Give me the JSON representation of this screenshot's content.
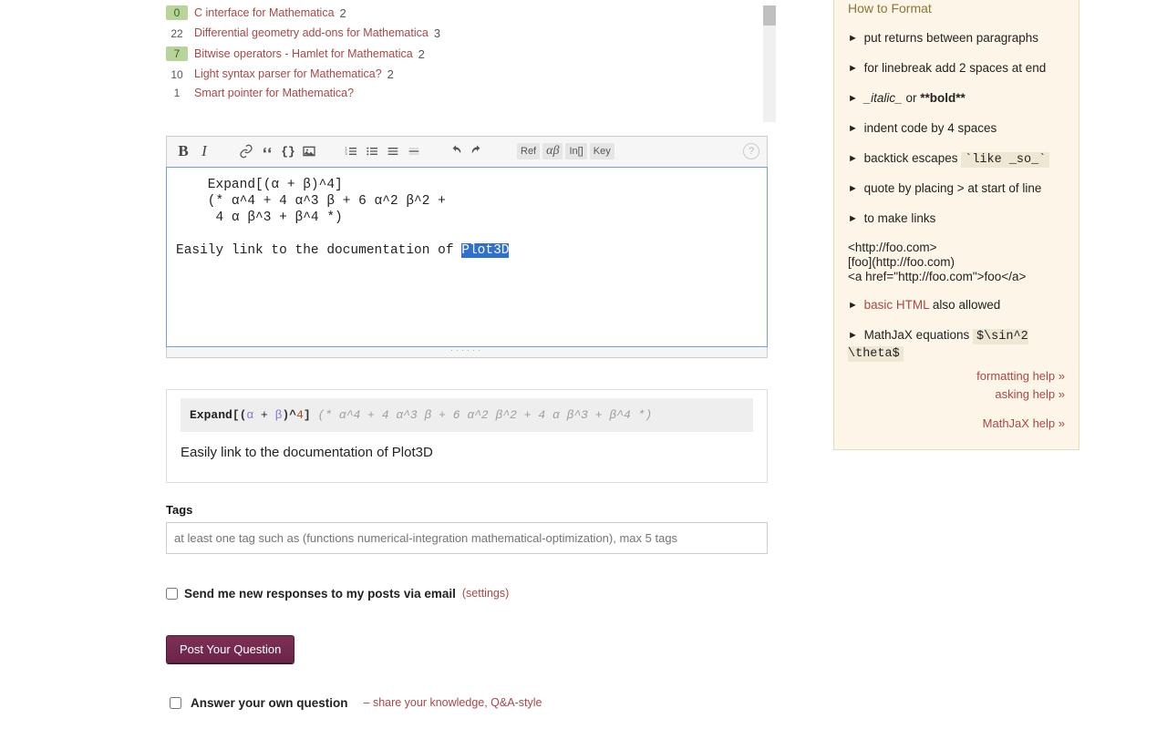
{
  "related": [
    {
      "votes": "0",
      "answered": true,
      "title": "C interface for Mathematica",
      "count": "2"
    },
    {
      "votes": "22",
      "answered": false,
      "title": "Differential geometry add-ons for Mathematica",
      "count": "3"
    },
    {
      "votes": "7",
      "answered": true,
      "title": "Bitwise operators - Hamlet for Mathematica",
      "count": "2"
    },
    {
      "votes": "10",
      "answered": false,
      "title": "Light syntax parser for Mathematica?",
      "count": "2"
    },
    {
      "votes": "1",
      "answered": false,
      "title": "Smart pointer for Mathematica?",
      "count": ""
    }
  ],
  "editor": {
    "line1": "    Expand[(α + β)^4]",
    "line2": "    (* α^4 + 4 α^3 β + 6 α^2 β^2 +",
    "line3": "     4 α β^3 + β^4 *)",
    "line5a": "Easily link to the documentation of ",
    "sel": "Plot3D"
  },
  "preview": {
    "code_kw": "Expand",
    "code_open": "[(",
    "code_a": "α",
    "code_plus": " + ",
    "code_b": "β",
    "code_close_exp": ")^",
    "code_exp": "4",
    "code_end": "]",
    "code_cmt1": "(* α^4 + 4 α^3 β + 6 α^2 β^2 +",
    "code_cmt2": " 4 α β^3 + β^4 *)",
    "text": "Easily link to the documentation of Plot3D"
  },
  "tags": {
    "label": "Tags",
    "placeholder": "at least one tag such as (functions numerical-integration mathematical-optimization), max 5 tags"
  },
  "email": {
    "text": "Send me new responses to my posts via email",
    "settings": "(settings)"
  },
  "post_btn": "Post Your Question",
  "answer_own": {
    "label": "Answer your own question",
    "share": "– share your knowledge, Q&A-style"
  },
  "toolbar": {
    "ref": "Ref",
    "greek": "αβ",
    "inout": "In[]",
    "key": "Key"
  },
  "help": {
    "title": "How to Format",
    "items": [
      "put returns between paragraphs",
      "for linebreak add 2 spaces at end"
    ],
    "italic_label": "_italic_",
    "or": " or ",
    "bold_label": "**bold**",
    "indent": "indent code by 4 spaces",
    "backtick_pre": "backtick escapes ",
    "backtick_code": "`like _so_`",
    "quote": "quote by placing > at start of line",
    "links_title": "to make links",
    "link_ex_1": "<http://foo.com>",
    "link_ex_2": "[foo](http://foo.com)",
    "link_ex_3": "<a href=\"http://foo.com\">foo</a>",
    "basic_html_pre": "",
    "basic_html": "basic HTML",
    "basic_html_post": " also allowed",
    "mathjax_pre": "MathJaX equations ",
    "mathjax_code": "$\\sin^2 \\theta$",
    "fmt_link": "formatting help »",
    "ask_link": "asking help »",
    "mj_link": "MathJaX help »"
  }
}
